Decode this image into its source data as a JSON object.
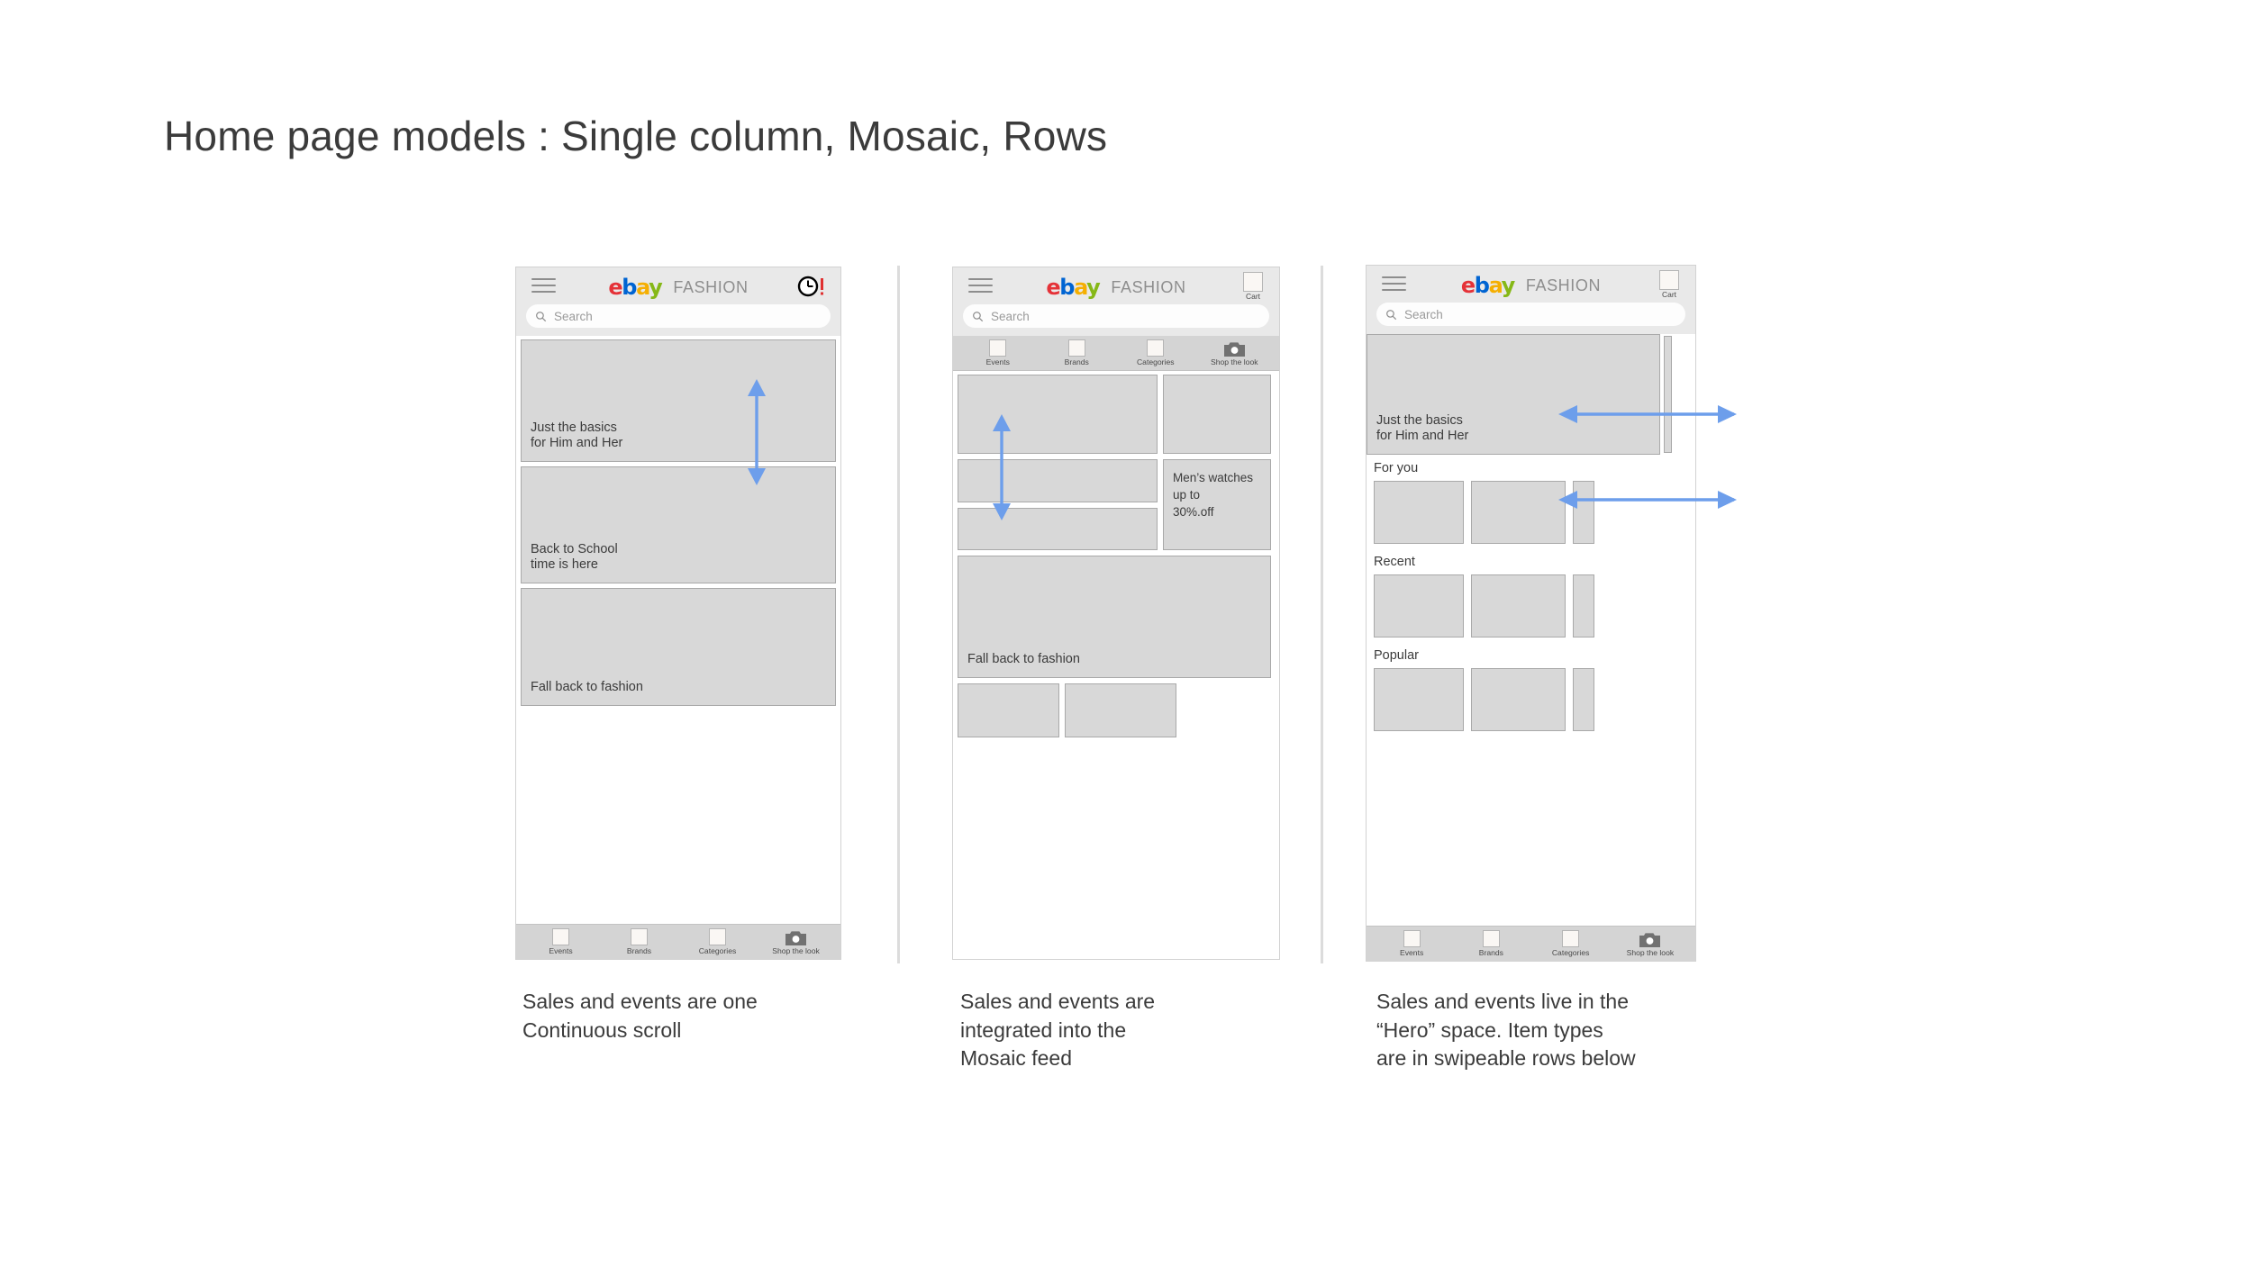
{
  "page_title": "Home page models : Single column, Mosaic, Rows",
  "brand": {
    "logo_letters": [
      "e",
      "b",
      "a",
      "y"
    ],
    "logo_colors": {
      "e": "#e53238",
      "b": "#0064d2",
      "a": "#f5af02",
      "y": "#86b817"
    },
    "suffix": "FASHION"
  },
  "search": {
    "placeholder": "Search",
    "icon": "search-icon"
  },
  "header_icons": {
    "menu": "hamburger-icon",
    "clock_alert": "clock-alert-icon",
    "cart_label": "Cart"
  },
  "tabbar": {
    "items": [
      {
        "label": "Events",
        "icon": "square-icon"
      },
      {
        "label": "Brands",
        "icon": "square-icon"
      },
      {
        "label": "Categories",
        "icon": "square-icon"
      },
      {
        "label": "Shop the look",
        "icon": "camera-icon"
      }
    ]
  },
  "accent_color": "#6d9eeb",
  "phone1": {
    "name": "Single column",
    "cards": [
      {
        "text": "Just the basics\nfor Him and Her"
      },
      {
        "text": "Back to School\ntime is here"
      },
      {
        "text": "Fall back to fashion"
      }
    ],
    "arrow": "vertical-scroll-arrow"
  },
  "phone2": {
    "name": "Mosaic",
    "cards": [
      {
        "text": ""
      },
      {
        "text": ""
      },
      {
        "text": ""
      },
      {
        "text": "Men’s watches\nup to\n30%.off"
      },
      {
        "text": ""
      },
      {
        "text": "Fall back to fashion"
      },
      {
        "text": ""
      },
      {
        "text": ""
      }
    ],
    "watch_promo": {
      "line1": "Men’s watches",
      "line2": "up to",
      "line3": "30%.off"
    },
    "fall_text": "Fall back to fashion",
    "arrow": "vertical-scroll-arrow"
  },
  "phone3": {
    "name": "Rows",
    "hero": {
      "text": "Just the basics\nfor Him and Her"
    },
    "rows": [
      {
        "title": "For you"
      },
      {
        "title": "Recent"
      },
      {
        "title": "Popular"
      }
    ],
    "arrows": [
      "horizontal-swipe-arrow-hero",
      "horizontal-swipe-arrow-row"
    ]
  },
  "captions": [
    "Sales and events are one\nContinuous scroll",
    "Sales and events are\nintegrated into the\nMosaic feed",
    "Sales and events live in the\n“Hero” space. Item types\nare in swipeable rows below"
  ]
}
